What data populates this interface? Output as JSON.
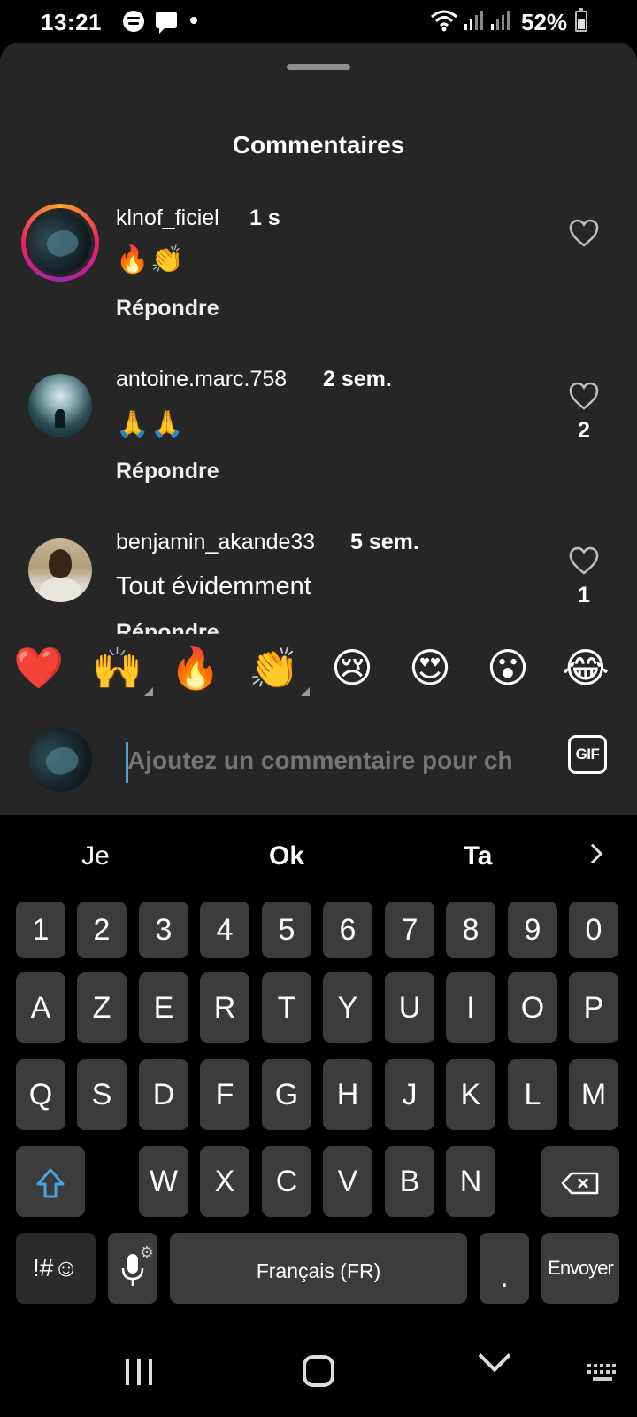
{
  "status_bar": {
    "time": "13:21",
    "battery": "52%",
    "icons": [
      "spotify-icon",
      "message-icon",
      "notification-dot",
      "wifi-icon",
      "signal-icon",
      "signal-icon",
      "battery-icon"
    ]
  },
  "sheet": {
    "title": "Commentaires"
  },
  "comments": [
    {
      "username": "klnof_ficiel",
      "time": "1 s",
      "text": "🔥👏",
      "reply_label": "Répondre",
      "likes": "",
      "has_story": true
    },
    {
      "username": "antoine.marc.758",
      "time": "2 sem.",
      "text": "🙏🙏",
      "reply_label": "Répondre",
      "likes": "2",
      "has_story": false
    },
    {
      "username": "benjamin_akande33",
      "time": "5 sem.",
      "text": "Tout évidemment",
      "reply_label": "Répondre",
      "likes": "1",
      "has_story": false
    }
  ],
  "reactions": [
    "❤️",
    "🙌",
    "🔥",
    "👏",
    "😢",
    "😍",
    "😮",
    "😂"
  ],
  "composer": {
    "placeholder": "Ajoutez un commentaire pour ch",
    "gif_label": "GIF"
  },
  "keyboard": {
    "suggestions": [
      "Je",
      "Ok",
      "Ta"
    ],
    "row_numbers": [
      "1",
      "2",
      "3",
      "4",
      "5",
      "6",
      "7",
      "8",
      "9",
      "0"
    ],
    "row1": [
      "A",
      "Z",
      "E",
      "R",
      "T",
      "Y",
      "U",
      "I",
      "O",
      "P"
    ],
    "row2": [
      "Q",
      "S",
      "D",
      "F",
      "G",
      "H",
      "J",
      "K",
      "L",
      "M"
    ],
    "row3": [
      "W",
      "X",
      "C",
      "V",
      "B",
      "N"
    ],
    "symbols_label": "!#☺",
    "space_label": "Français (FR)",
    "period_label": ".",
    "send_label": "Envoyer"
  },
  "colors": {
    "sheet_bg": "#262626",
    "key_bg": "#3c3c3c",
    "accent_blue": "#4aa3df"
  }
}
